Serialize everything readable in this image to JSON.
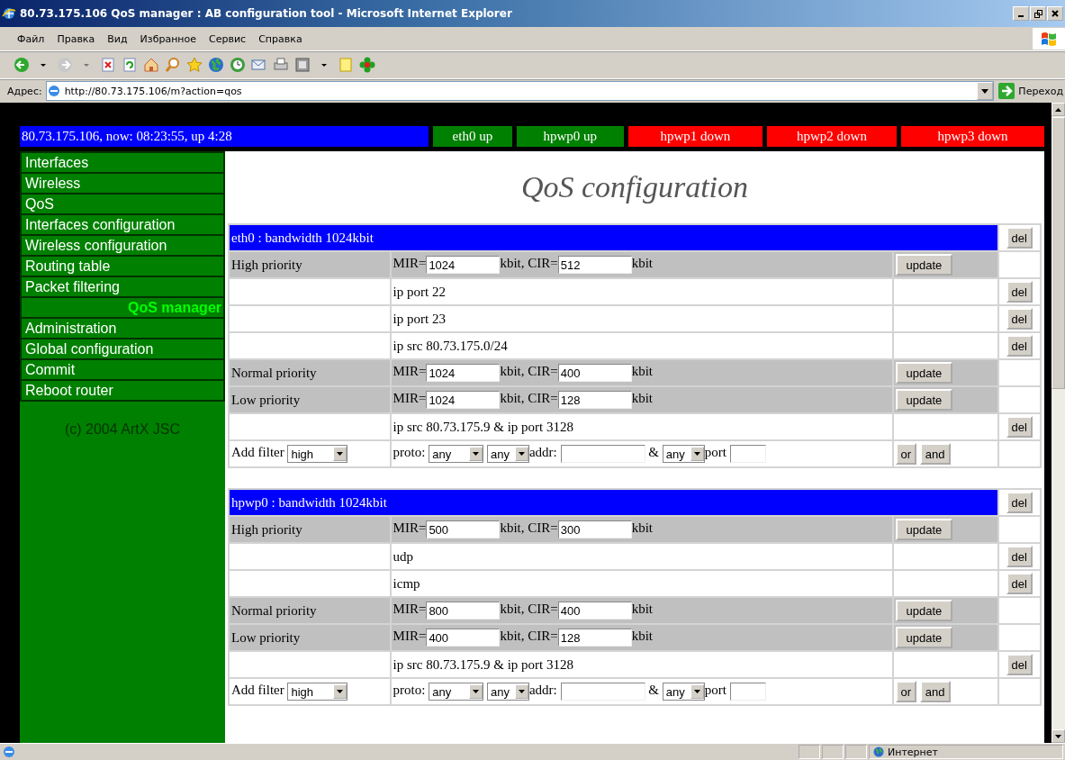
{
  "window": {
    "title": "80.73.175.106 QoS manager : AB configuration tool - Microsoft Internet Explorer"
  },
  "menu": [
    "Файл",
    "Правка",
    "Вид",
    "Избранное",
    "Сервис",
    "Справка"
  ],
  "address": {
    "label": "Адрес:",
    "url": "http://80.73.175.106/m?action=qos",
    "go": "Переход"
  },
  "status_line": {
    "info": "80.73.175.106, now: 08:23:55, up 4:28",
    "interfaces": [
      {
        "label": "eth0 up",
        "color": "#008000"
      },
      {
        "label": "hpwp0 up",
        "color": "#008000"
      },
      {
        "label": "hpwp1 down",
        "color": "#ff0000"
      },
      {
        "label": "hpwp2 down",
        "color": "#ff0000"
      },
      {
        "label": "hpwp3 down",
        "color": "#ff0000"
      }
    ]
  },
  "sidebar": {
    "items": [
      {
        "label": "Interfaces",
        "selected": false
      },
      {
        "label": "Wireless",
        "selected": false
      },
      {
        "label": "QoS",
        "selected": false
      },
      {
        "label": "Interfaces configuration",
        "selected": false
      },
      {
        "label": "Wireless configuration",
        "selected": false
      },
      {
        "label": "Routing table",
        "selected": false
      },
      {
        "label": "Packet filtering",
        "selected": false
      },
      {
        "label": "QoS manager",
        "selected": true
      },
      {
        "label": "Administration",
        "selected": false
      },
      {
        "label": "Global configuration",
        "selected": false
      },
      {
        "label": "Commit",
        "selected": false
      },
      {
        "label": "Reboot router",
        "selected": false
      }
    ],
    "copyright": "(c) 2004 ArtX JSC"
  },
  "page_title": "QoS configuration",
  "sections": [
    {
      "header": "eth0 : bandwidth 1024kbit",
      "delete": "del",
      "rows": [
        {
          "kind": "priority",
          "label": "High priority",
          "mir_label": "MIR=",
          "mir": "1024",
          "cir_label": "kbit, CIR=",
          "cir": "512",
          "unit": "kbit",
          "button": "update"
        },
        {
          "kind": "filter",
          "rule": "ip port 22",
          "button": "del"
        },
        {
          "kind": "filter",
          "rule": "ip port 23",
          "button": "del"
        },
        {
          "kind": "filter",
          "rule": "ip src 80.73.175.0/24",
          "button": "del"
        },
        {
          "kind": "priority",
          "label": "Normal priority",
          "mir_label": "MIR=",
          "mir": "1024",
          "cir_label": "kbit, CIR=",
          "cir": "400",
          "unit": "kbit",
          "button": "update"
        },
        {
          "kind": "priority",
          "label": "Low priority",
          "mir_label": "MIR=",
          "mir": "1024",
          "cir_label": "kbit, CIR=",
          "cir": "128",
          "unit": "kbit",
          "button": "update"
        },
        {
          "kind": "filter",
          "rule": "ip src 80.73.175.9 & ip port 3128",
          "button": "del"
        },
        {
          "kind": "add",
          "label": "Add filter",
          "priority": "high",
          "proto_label": "proto:",
          "proto": "any",
          "addr_type": "any",
          "addr_label": "addr:",
          "join": "&",
          "port_type": "any",
          "port_label": "port",
          "buttons": [
            "or",
            "and"
          ]
        }
      ]
    },
    {
      "header": "hpwp0 : bandwidth 1024kbit",
      "delete": "del",
      "rows": [
        {
          "kind": "priority",
          "label": "High priority",
          "mir_label": "MIR=",
          "mir": "500",
          "cir_label": "kbit, CIR=",
          "cir": "300",
          "unit": "kbit",
          "button": "update"
        },
        {
          "kind": "filter",
          "rule": "udp",
          "button": "del"
        },
        {
          "kind": "filter",
          "rule": "icmp",
          "button": "del"
        },
        {
          "kind": "priority",
          "label": "Normal priority",
          "mir_label": "MIR=",
          "mir": "800",
          "cir_label": "kbit, CIR=",
          "cir": "400",
          "unit": "kbit",
          "button": "update"
        },
        {
          "kind": "priority",
          "label": "Low priority",
          "mir_label": "MIR=",
          "mir": "400",
          "cir_label": "kbit, CIR=",
          "cir": "128",
          "unit": "kbit",
          "button": "update"
        },
        {
          "kind": "filter",
          "rule": "ip src 80.73.175.9 & ip port 3128",
          "button": "del"
        },
        {
          "kind": "add",
          "label": "Add filter",
          "priority": "high",
          "proto_label": "proto:",
          "proto": "any",
          "addr_type": "any",
          "addr_label": "addr:",
          "join": "&",
          "port_type": "any",
          "port_label": "port",
          "buttons": [
            "or",
            "and"
          ]
        }
      ]
    }
  ],
  "status_bar": {
    "zone": "Интернет"
  }
}
